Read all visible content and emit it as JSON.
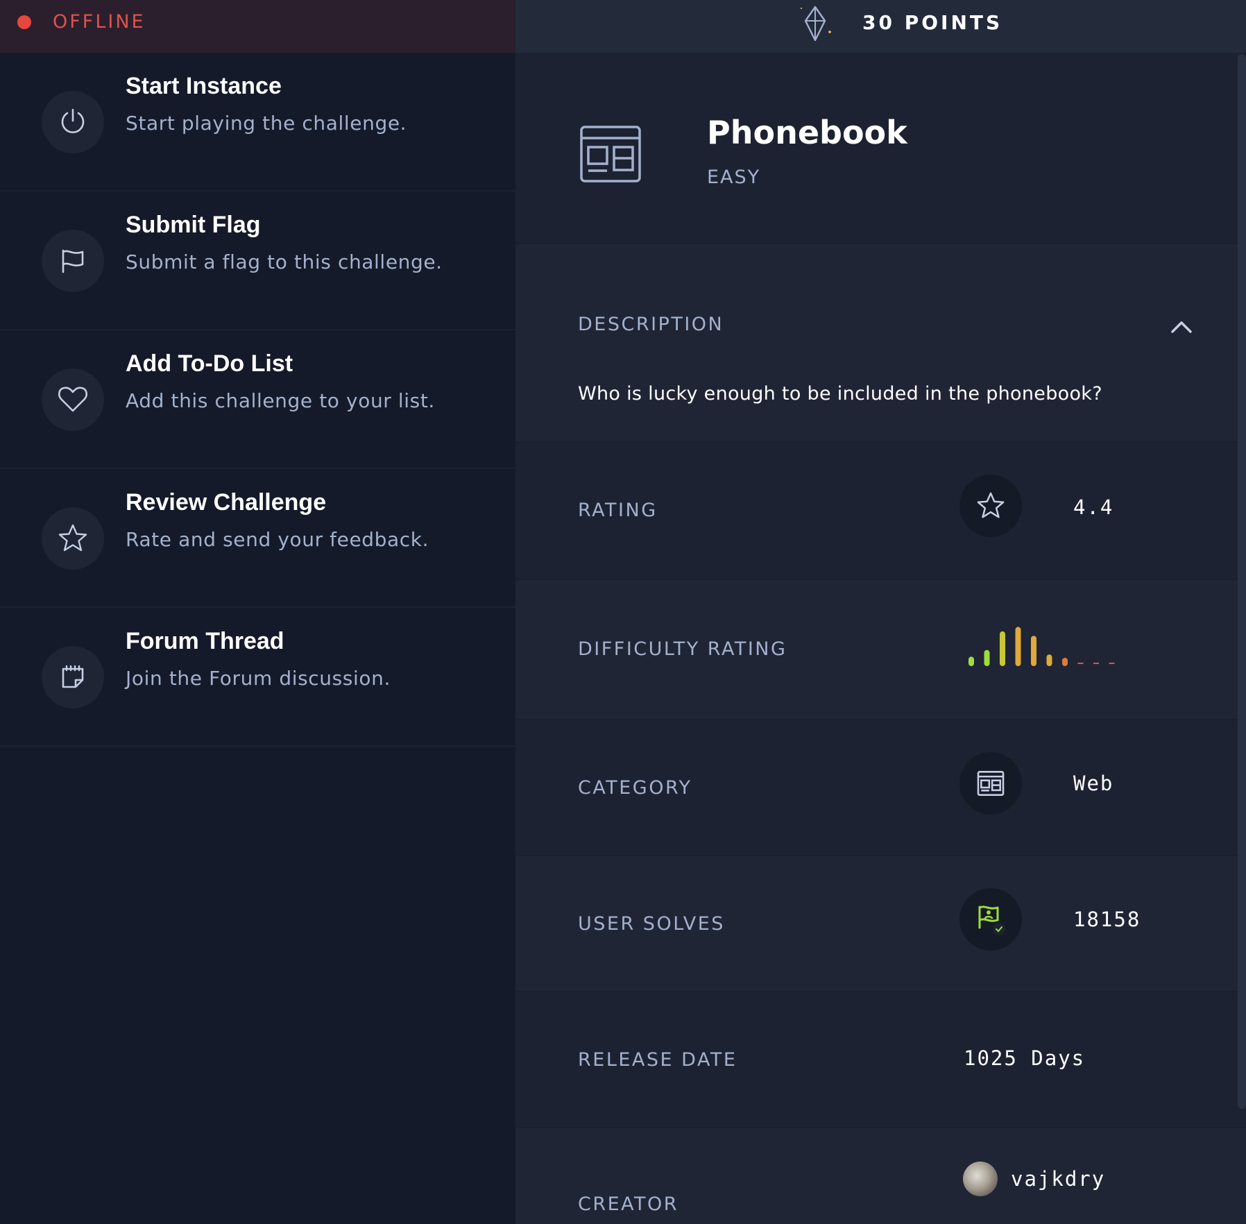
{
  "status": {
    "label": "OFFLINE",
    "color": "#e8473d"
  },
  "points": {
    "label": "30 POINTS",
    "icon": "diamond-icon"
  },
  "actions": [
    {
      "title": "Start Instance",
      "subtitle": "Start playing the challenge.",
      "icon": "power-icon"
    },
    {
      "title": "Submit Flag",
      "subtitle": "Submit a flag to this challenge.",
      "icon": "flag-icon"
    },
    {
      "title": "Add To-Do List",
      "subtitle": "Add this challenge to your list.",
      "icon": "heart-icon"
    },
    {
      "title": "Review Challenge",
      "subtitle": "Rate and send your feedback.",
      "icon": "star-icon"
    },
    {
      "title": "Forum Thread",
      "subtitle": "Join the Forum discussion.",
      "icon": "notepad-icon"
    }
  ],
  "challenge": {
    "name": "Phonebook",
    "difficulty": "EASY",
    "icon": "web-category-icon"
  },
  "description": {
    "label": "DESCRIPTION",
    "text": "Who is lucky enough to be included in the phonebook?",
    "toggle_icon": "chevron-up-icon"
  },
  "details": {
    "rating": {
      "label": "RATING",
      "value": "4.4",
      "icon": "star-icon"
    },
    "difficulty_rating": {
      "label": "DIFFICULTY RATING",
      "bars": [
        {
          "level": 0.15,
          "color": "#9fdc3c"
        },
        {
          "level": 0.3,
          "color": "#9fdc3c"
        },
        {
          "level": 0.72,
          "color": "#c8c832"
        },
        {
          "level": 0.82,
          "color": "#e0a93a"
        },
        {
          "level": 0.62,
          "color": "#e0a93a"
        },
        {
          "level": 0.2,
          "color": "#e0a93a"
        },
        {
          "level": 0.08,
          "color": "#e07a3a"
        },
        {
          "level": 0,
          "color": "#e0514a"
        },
        {
          "level": 0,
          "color": "#e0514a"
        },
        {
          "level": 0,
          "color": "#e0514a"
        }
      ]
    },
    "category": {
      "label": "CATEGORY",
      "value": "Web",
      "icon": "web-category-icon"
    },
    "user_solves": {
      "label": "USER SOLVES",
      "value": "18158",
      "icon": "solved-flag-icon"
    },
    "release_date": {
      "label": "RELEASE DATE",
      "value": "1025 Days"
    },
    "creator": {
      "label": "CREATOR",
      "value": "vajkdry"
    }
  },
  "colors": {
    "accent_green": "#9fdc3c",
    "accent_orange": "#e0a93a",
    "accent_red": "#e0514a"
  }
}
